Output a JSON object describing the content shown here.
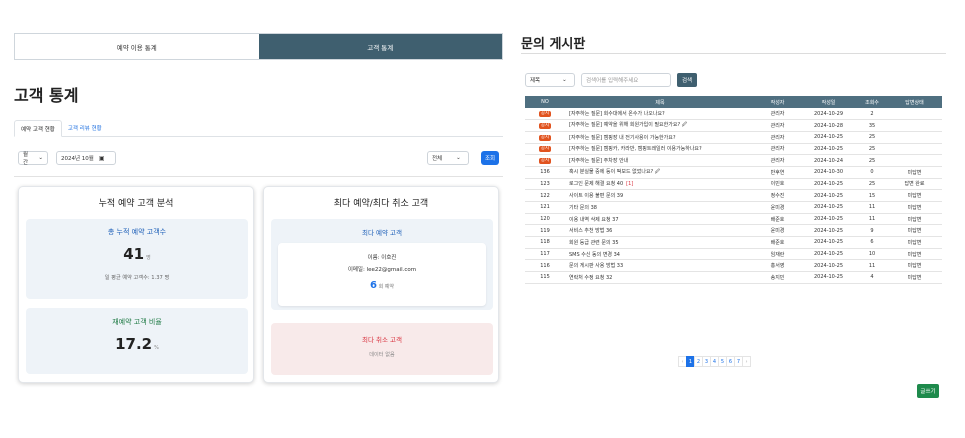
{
  "left": {
    "top_tabs": [
      {
        "label": "예약 이용 통계",
        "active": false
      },
      {
        "label": "고객 통계",
        "active": true
      }
    ],
    "title": "고객 통계",
    "sub_tabs": [
      {
        "label": "예약 고객 현황",
        "active": true
      },
      {
        "label": "고객 리뷰 현황",
        "active": false
      }
    ],
    "filters": {
      "period": "월간",
      "month": "2024년 10월",
      "scope": "전체",
      "search_label": "조회"
    },
    "card_accumulated": {
      "title": "누적 예약 고객 분석",
      "total_label": "총 누적 예약 고객수",
      "total_value": "41",
      "total_unit": "명",
      "avg_note": "일 평균 예약 고객수: 1.37 명",
      "rebook_label": "재예약 고객 비율",
      "rebook_value": "17.2",
      "rebook_unit": "%"
    },
    "card_top": {
      "title": "최다 예약/최다 취소 고객",
      "top_booking_label": "최다 예약 고객",
      "name_line": "이름: 이호진",
      "email_line": "이메일: lee22@gmail.com",
      "count_value": "6",
      "count_unit": "회 예약",
      "top_cancel_label": "최다 취소 고객",
      "no_data": "데이터 없음"
    }
  },
  "right": {
    "title": "문의 게시판",
    "search": {
      "field": "제목",
      "placeholder": "검색어를 입력해주세요",
      "button": "검색"
    },
    "columns": [
      "NO",
      "제목",
      "작성자",
      "작성일",
      "조회수",
      "답변상태"
    ],
    "rows": [
      {
        "no": "공지",
        "title": "[자주하는 질문] 회수대에서 온수가 나오나요?",
        "author": "관리자",
        "date": "2024-10-29",
        "views": "2",
        "status": "",
        "notice": true,
        "comments": ""
      },
      {
        "no": "공지",
        "title": "[자주하는 질문] 예약을 위해 회원가입이 필요한가요? 🖉",
        "author": "관리자",
        "date": "2024-10-28",
        "views": "35",
        "status": "",
        "notice": true,
        "comments": ""
      },
      {
        "no": "공지",
        "title": "[자주하는 질문] 캠핑장 내 전기사용이 가능한가요?",
        "author": "관리자",
        "date": "2024-10-25",
        "views": "25",
        "status": "",
        "notice": true,
        "comments": ""
      },
      {
        "no": "공지",
        "title": "[자주하는 질문] 캠핑카, 카라반, 캠핑트레일러 이용가능하나요?",
        "author": "관리자",
        "date": "2024-10-25",
        "views": "25",
        "status": "",
        "notice": true,
        "comments": ""
      },
      {
        "no": "공지",
        "title": "[자주하는 질문] 주차장 안내",
        "author": "관리자",
        "date": "2024-10-24",
        "views": "25",
        "status": "",
        "notice": true,
        "comments": ""
      },
      {
        "no": "136",
        "title": "혹시 분실물 중에 등이 떡보드 없었나요? 🖉",
        "author": "반후연",
        "date": "2024-10-30",
        "views": "0",
        "status": "미답변",
        "notice": false,
        "comments": ""
      },
      {
        "no": "123",
        "title": "로그인 문제 해결 요청 40",
        "author": "이민호",
        "date": "2024-10-25",
        "views": "25",
        "status": "답변 완료",
        "notice": false,
        "comments": "[1]"
      },
      {
        "no": "122",
        "title": "사이트 이용 불편 문의 39",
        "author": "정수진",
        "date": "2024-10-25",
        "views": "15",
        "status": "미답변",
        "notice": false,
        "comments": ""
      },
      {
        "no": "121",
        "title": "기타 문의 38",
        "author": "윤미경",
        "date": "2024-10-25",
        "views": "11",
        "status": "미답변",
        "notice": false,
        "comments": ""
      },
      {
        "no": "120",
        "title": "이용 내역 삭제 요청 37",
        "author": "배준호",
        "date": "2024-10-25",
        "views": "11",
        "status": "미답변",
        "notice": false,
        "comments": ""
      },
      {
        "no": "119",
        "title": "서비스 추천 방법 36",
        "author": "윤미경",
        "date": "2024-10-25",
        "views": "9",
        "status": "미답변",
        "notice": false,
        "comments": ""
      },
      {
        "no": "118",
        "title": "회원 등급 관련 문의 35",
        "author": "배준호",
        "date": "2024-10-25",
        "views": "6",
        "status": "미답변",
        "notice": false,
        "comments": ""
      },
      {
        "no": "117",
        "title": "SMS 수신 동의 변경 34",
        "author": "임재란",
        "date": "2024-10-25",
        "views": "10",
        "status": "미답변",
        "notice": false,
        "comments": ""
      },
      {
        "no": "116",
        "title": "문의 게시판 사용 방법 33",
        "author": "홍서영",
        "date": "2024-10-25",
        "views": "11",
        "status": "미답변",
        "notice": false,
        "comments": ""
      },
      {
        "no": "115",
        "title": "연락처 수정 요청 32",
        "author": "송지민",
        "date": "2024-10-25",
        "views": "4",
        "status": "미답변",
        "notice": false,
        "comments": ""
      }
    ],
    "pagination": [
      "‹",
      "1",
      "2",
      "3",
      "4",
      "5",
      "6",
      "7",
      "›"
    ],
    "write_button": "글쓰기"
  },
  "colors": {
    "header_dark": "#3f5f6f",
    "table_header": "#4f6f80",
    "primary": "#1d72e8",
    "notice_badge": "#e1531f",
    "write_green": "#1e8a4c",
    "cancel_red": "#d9333f"
  }
}
